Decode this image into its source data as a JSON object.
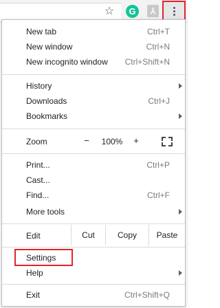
{
  "toolbar": {
    "icons": [
      "star-icon",
      "grammarly-icon",
      "pdf-icon",
      "more-menu-icon"
    ],
    "grammarly_letter": "G",
    "menu_highlight_color": "#e0232e"
  },
  "menu": {
    "new_tab": {
      "label": "New tab",
      "shortcut": "Ctrl+T"
    },
    "new_window": {
      "label": "New window",
      "shortcut": "Ctrl+N"
    },
    "new_incognito": {
      "label": "New incognito window",
      "shortcut": "Ctrl+Shift+N"
    },
    "history": {
      "label": "History"
    },
    "downloads": {
      "label": "Downloads",
      "shortcut": "Ctrl+J"
    },
    "bookmarks": {
      "label": "Bookmarks"
    },
    "zoom": {
      "label": "Zoom",
      "minus": "−",
      "value": "100%",
      "plus": "+"
    },
    "print": {
      "label": "Print...",
      "shortcut": "Ctrl+P"
    },
    "cast": {
      "label": "Cast..."
    },
    "find": {
      "label": "Find...",
      "shortcut": "Ctrl+F"
    },
    "more_tools": {
      "label": "More tools"
    },
    "edit": {
      "label": "Edit",
      "cut": "Cut",
      "copy": "Copy",
      "paste": "Paste"
    },
    "settings": {
      "label": "Settings"
    },
    "help": {
      "label": "Help"
    },
    "exit": {
      "label": "Exit",
      "shortcut": "Ctrl+Shift+Q"
    }
  }
}
